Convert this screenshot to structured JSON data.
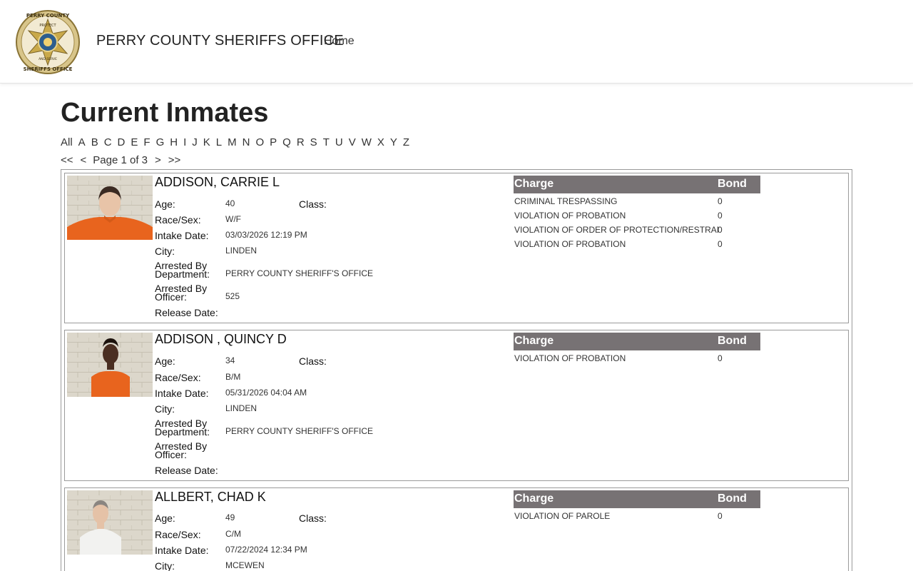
{
  "header": {
    "brand": "PERRY COUNTY SHERIFFS OFFICE",
    "nav_home": "Home",
    "badge_text_top": "PERRY COUNTY",
    "badge_text_mid": "PROTECT",
    "badge_text_bottom": "SHERIFFS OFFICE",
    "badge_text_serve": "AND SERVE"
  },
  "page": {
    "title": "Current Inmates",
    "alphabet": [
      "All",
      "A",
      "B",
      "C",
      "D",
      "E",
      "F",
      "G",
      "H",
      "I",
      "J",
      "K",
      "L",
      "M",
      "N",
      "O",
      "P",
      "Q",
      "R",
      "S",
      "T",
      "U",
      "V",
      "W",
      "X",
      "Y",
      "Z"
    ],
    "pager": {
      "first": "<<",
      "prev": "<",
      "status": "Page 1 of 3",
      "next": ">",
      "last": ">>"
    }
  },
  "labels": {
    "age": "Age:",
    "class": "Class:",
    "race_sex": "Race/Sex:",
    "intake_date": "Intake Date:",
    "city": "City:",
    "arrested_by_dept_1": "Arrested By",
    "arrested_by_dept_2": "Department:",
    "arrested_by_officer_1": "Arrested By",
    "arrested_by_officer_2": "Officer:",
    "release_date": "Release Date:",
    "charge": "Charge",
    "bond": "Bond"
  },
  "inmates": [
    {
      "name": "ADDISON, CARRIE L",
      "age": "40",
      "class": "",
      "race_sex": "W/F",
      "intake_date": "03/03/2026 12:19 PM",
      "city": "LINDEN",
      "department": "PERRY COUNTY SHERIFF'S OFFICE",
      "officer": "525",
      "release_date": "",
      "charges": [
        {
          "charge": "CRIMINAL TRESPASSING",
          "bond": "0"
        },
        {
          "charge": "VIOLATION OF PROBATION",
          "bond": "0"
        },
        {
          "charge": "VIOLATION OF ORDER OF PROTECTION/RESTRAI",
          "bond": "0"
        },
        {
          "charge": "VIOLATION OF PROBATION",
          "bond": "0"
        }
      ]
    },
    {
      "name": "ADDISON , QUINCY D",
      "age": "34",
      "class": "",
      "race_sex": "B/M",
      "intake_date": "05/31/2026 04:04 AM",
      "city": "LINDEN",
      "department": "PERRY COUNTY SHERIFF'S OFFICE",
      "officer": "",
      "release_date": "",
      "charges": [
        {
          "charge": "VIOLATION OF PROBATION",
          "bond": "0"
        }
      ]
    },
    {
      "name": "ALLBERT, CHAD K",
      "age": "49",
      "class": "",
      "race_sex": "C/M",
      "intake_date": "07/22/2024 12:34 PM",
      "city": "MCEWEN",
      "charges": [
        {
          "charge": "VIOLATION OF PAROLE",
          "bond": "0"
        }
      ]
    }
  ],
  "colors": {
    "table_header_bg": "#777274",
    "badge_gold": "#c9a94a",
    "uniform_orange": "#e8641e"
  }
}
